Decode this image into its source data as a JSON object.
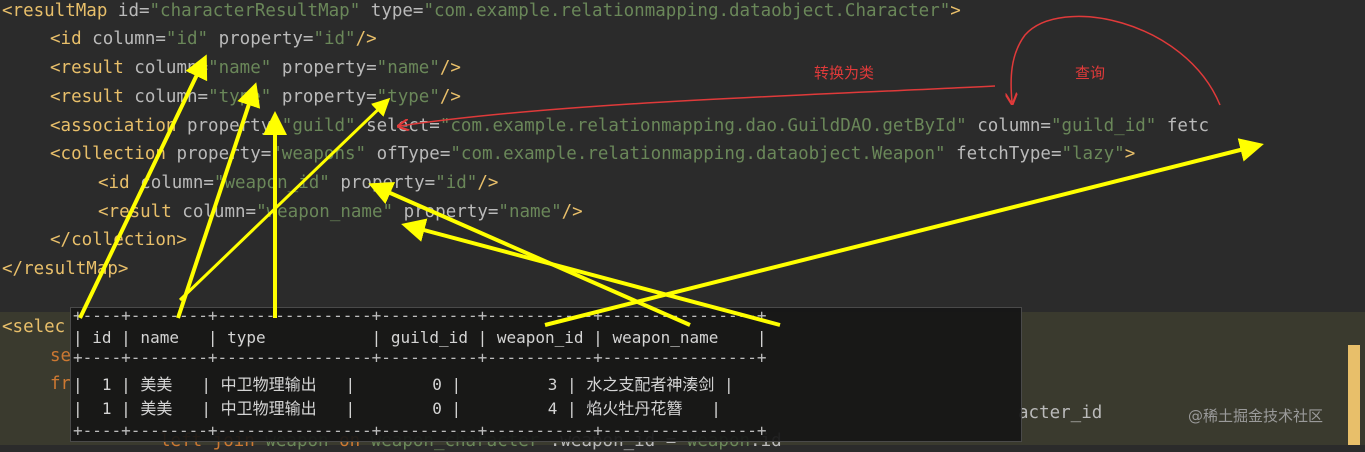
{
  "code_lines": [
    {
      "id": "l1",
      "parts": [
        [
          "tag",
          "<resultMap "
        ],
        [
          "attr",
          "id="
        ],
        [
          "val",
          "\"characterResultMap\" "
        ],
        [
          "attr",
          "type="
        ],
        [
          "val",
          "\"com.example.relationmapping.dataobject.Character\""
        ],
        [
          "tag",
          ">"
        ]
      ]
    },
    {
      "id": "l2",
      "parts": [
        [
          "tag",
          "<id "
        ],
        [
          "attr",
          "column="
        ],
        [
          "val",
          "\"id\" "
        ],
        [
          "attr",
          "property="
        ],
        [
          "val",
          "\"id\""
        ],
        [
          "tag",
          "/>"
        ]
      ]
    },
    {
      "id": "l3",
      "parts": [
        [
          "tag",
          "<result "
        ],
        [
          "attr",
          "column="
        ],
        [
          "val",
          "\"name\" "
        ],
        [
          "attr",
          "property="
        ],
        [
          "val",
          "\"name\""
        ],
        [
          "tag",
          "/>"
        ]
      ]
    },
    {
      "id": "l4",
      "parts": [
        [
          "tag",
          "<result "
        ],
        [
          "attr",
          "column="
        ],
        [
          "val",
          "\"type\" "
        ],
        [
          "attr",
          "property="
        ],
        [
          "val",
          "\"type\""
        ],
        [
          "tag",
          "/>"
        ]
      ]
    },
    {
      "id": "l5",
      "parts": [
        [
          "tag",
          "<association "
        ],
        [
          "attr",
          "property="
        ],
        [
          "val",
          "\"guild\" "
        ],
        [
          "attr",
          "select="
        ],
        [
          "val",
          "\"com.example.relationmapping.dao.GuildDAO.getById\" "
        ],
        [
          "attr",
          "column="
        ],
        [
          "val",
          "\"guild_id\" "
        ],
        [
          "attr",
          "fetc"
        ]
      ]
    },
    {
      "id": "l6",
      "parts": [
        [
          "tag",
          "<collection "
        ],
        [
          "attr",
          "property="
        ],
        [
          "val",
          "\"weapons\" "
        ],
        [
          "attr",
          "ofType="
        ],
        [
          "val",
          "\"com.example.relationmapping.dataobject.Weapon\" "
        ],
        [
          "attr",
          "fetchType="
        ],
        [
          "val",
          "\"lazy\""
        ],
        [
          "tag",
          ">"
        ]
      ]
    },
    {
      "id": "l7",
      "parts": [
        [
          "tag",
          "<id "
        ],
        [
          "attr",
          "column="
        ],
        [
          "val",
          "\"weapon_id\" "
        ],
        [
          "attr",
          "property="
        ],
        [
          "val",
          "\"id\""
        ],
        [
          "tag",
          "/>"
        ]
      ]
    },
    {
      "id": "l8",
      "parts": [
        [
          "tag",
          "<result "
        ],
        [
          "attr",
          "column="
        ],
        [
          "val",
          "\"weapon_name\" "
        ],
        [
          "attr",
          "property="
        ],
        [
          "val",
          "\"name\""
        ],
        [
          "tag",
          "/>"
        ]
      ]
    },
    {
      "id": "l9",
      "parts": [
        [
          "tag",
          "</collection>"
        ]
      ]
    },
    {
      "id": "l10",
      "parts": [
        [
          "tag",
          "</resultMap>"
        ]
      ]
    },
    {
      "id": "l11",
      "parts": [
        [
          "tag",
          "<selec"
        ]
      ]
    },
    {
      "id": "l12",
      "parts": [
        [
          "kw",
          "se"
        ]
      ]
    },
    {
      "id": "l13",
      "parts": [
        [
          "kw",
          "fr"
        ]
      ]
    },
    {
      "id": "l14",
      "parts": [
        [
          "attr",
          "acter_id"
        ]
      ]
    },
    {
      "id": "l15",
      "parts": [
        [
          "kw",
          "left join "
        ],
        [
          "val",
          "weapon "
        ],
        [
          "kw",
          "on "
        ],
        [
          "val",
          "weapon_character "
        ],
        [
          "attr",
          ".weapon_id = "
        ],
        [
          "val",
          "weapon"
        ],
        [
          "attr",
          ".id"
        ]
      ]
    }
  ],
  "result_table": {
    "border": "+----+--------+----------------+----------+-----------+----------------+",
    "header": "| id | name   | type           | guild_id | weapon_id | weapon_name    |",
    "rows": [
      "|  1 | 美美   | 中卫物理输出   |        0 |         3 | 水之支配者神湊剑 |",
      "|  1 | 美美   | 中卫物理输出   |        0 |         4 | 焰火牡丹花簪   |"
    ]
  },
  "annotations": {
    "convert": "转换为类",
    "query": "查询"
  },
  "watermark": "@稀土掘金技术社区",
  "colors": {
    "arrow": "#ffff00",
    "annotation": "#e03a3a"
  }
}
